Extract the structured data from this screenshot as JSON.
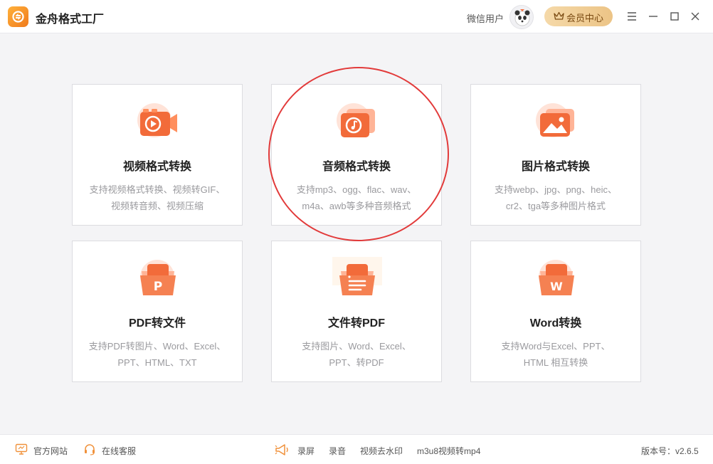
{
  "app": {
    "title": "金舟格式工厂",
    "user_name": "微信用户",
    "vip_label": "会员中心"
  },
  "cards": [
    {
      "title": "视频格式转换",
      "desc": [
        "支持视频格式转换、视频转GIF、",
        "视频转音频、视频压缩"
      ],
      "icon": "video-play-icon"
    },
    {
      "title": "音频格式转换",
      "desc": [
        "支持mp3、ogg、flac、wav、",
        "m4a、awb等多种音频格式"
      ],
      "icon": "music-note-icon"
    },
    {
      "title": "图片格式转换",
      "desc": [
        "支持webp、jpg、png、heic、",
        "cr2、tga等多种图片格式"
      ],
      "icon": "image-icon"
    },
    {
      "title": "PDF转文件",
      "desc": [
        "支持PDF转图片、Word、Excel、",
        "PPT、HTML、TXT"
      ],
      "icon": "pdf-p-icon",
      "icon_letter": "P"
    },
    {
      "title": "文件转PDF",
      "desc": [
        "支持图片、Word、Excel、",
        "PPT、转PDF"
      ],
      "icon": "document-lines-icon"
    },
    {
      "title": "Word转换",
      "desc": [
        "支持Word与Excel、PPT、",
        "HTML 相互转换"
      ],
      "icon": "word-w-icon",
      "icon_letter": "W"
    }
  ],
  "footer": {
    "website": "官方网站",
    "service": "在线客服",
    "tools": [
      "录屏",
      "录音",
      "视频去水印",
      "m3u8视频转mp4"
    ],
    "version": "版本号：v2.6.5"
  },
  "colors": {
    "accent_orange": "#f26b3a",
    "accent_light": "#ffd0bd",
    "highlight_red": "#e23a3a",
    "vip_gold": "#ecc486"
  }
}
